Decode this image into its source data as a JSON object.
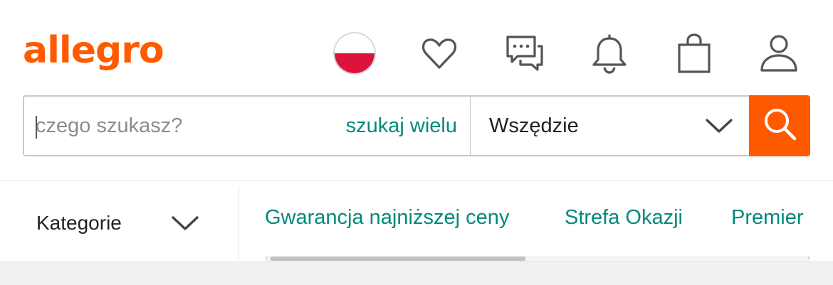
{
  "header": {
    "logo_text": "allegro",
    "brand_color": "#ff5a00",
    "icons": {
      "language": "poland-flag-icon",
      "favorites": "heart-icon",
      "messages": "chat-bubbles-icon",
      "notifications": "bell-icon",
      "cart": "shopping-bag-icon",
      "account": "user-icon"
    }
  },
  "search": {
    "placeholder": "czego szukasz?",
    "value": "",
    "multi_search_label": "szukaj wielu",
    "scope_value": "Wszędzie",
    "button_icon": "magnifier-icon"
  },
  "nav": {
    "categories_label": "Kategorie",
    "links": [
      "Gwarancja najniższej ceny",
      "Strefa Okazji",
      "Premier"
    ],
    "link_color": "#00897b"
  }
}
